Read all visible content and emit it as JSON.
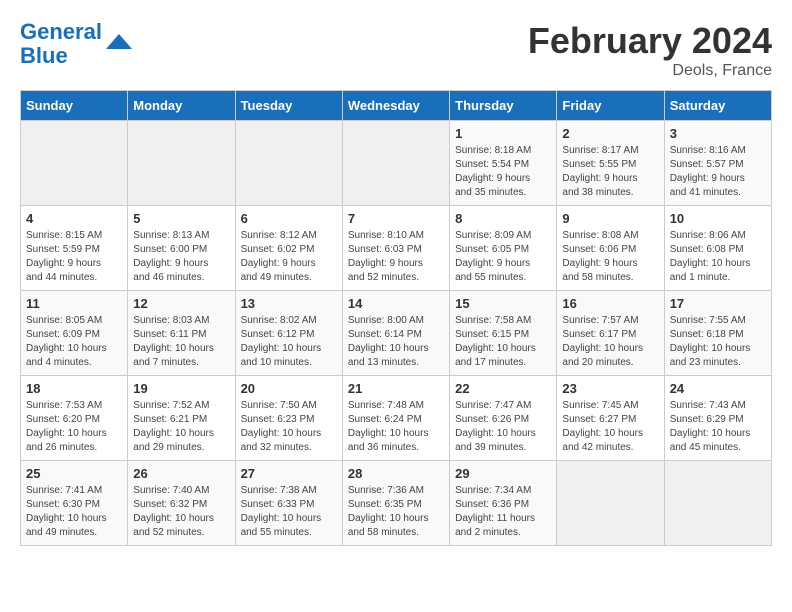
{
  "header": {
    "logo_line1": "General",
    "logo_line2": "Blue",
    "title": "February 2024",
    "subtitle": "Deols, France"
  },
  "days_of_week": [
    "Sunday",
    "Monday",
    "Tuesday",
    "Wednesday",
    "Thursday",
    "Friday",
    "Saturday"
  ],
  "weeks": [
    [
      {
        "day": "",
        "info": ""
      },
      {
        "day": "",
        "info": ""
      },
      {
        "day": "",
        "info": ""
      },
      {
        "day": "",
        "info": ""
      },
      {
        "day": "1",
        "info": "Sunrise: 8:18 AM\nSunset: 5:54 PM\nDaylight: 9 hours\nand 35 minutes."
      },
      {
        "day": "2",
        "info": "Sunrise: 8:17 AM\nSunset: 5:55 PM\nDaylight: 9 hours\nand 38 minutes."
      },
      {
        "day": "3",
        "info": "Sunrise: 8:16 AM\nSunset: 5:57 PM\nDaylight: 9 hours\nand 41 minutes."
      }
    ],
    [
      {
        "day": "4",
        "info": "Sunrise: 8:15 AM\nSunset: 5:59 PM\nDaylight: 9 hours\nand 44 minutes."
      },
      {
        "day": "5",
        "info": "Sunrise: 8:13 AM\nSunset: 6:00 PM\nDaylight: 9 hours\nand 46 minutes."
      },
      {
        "day": "6",
        "info": "Sunrise: 8:12 AM\nSunset: 6:02 PM\nDaylight: 9 hours\nand 49 minutes."
      },
      {
        "day": "7",
        "info": "Sunrise: 8:10 AM\nSunset: 6:03 PM\nDaylight: 9 hours\nand 52 minutes."
      },
      {
        "day": "8",
        "info": "Sunrise: 8:09 AM\nSunset: 6:05 PM\nDaylight: 9 hours\nand 55 minutes."
      },
      {
        "day": "9",
        "info": "Sunrise: 8:08 AM\nSunset: 6:06 PM\nDaylight: 9 hours\nand 58 minutes."
      },
      {
        "day": "10",
        "info": "Sunrise: 8:06 AM\nSunset: 6:08 PM\nDaylight: 10 hours\nand 1 minute."
      }
    ],
    [
      {
        "day": "11",
        "info": "Sunrise: 8:05 AM\nSunset: 6:09 PM\nDaylight: 10 hours\nand 4 minutes."
      },
      {
        "day": "12",
        "info": "Sunrise: 8:03 AM\nSunset: 6:11 PM\nDaylight: 10 hours\nand 7 minutes."
      },
      {
        "day": "13",
        "info": "Sunrise: 8:02 AM\nSunset: 6:12 PM\nDaylight: 10 hours\nand 10 minutes."
      },
      {
        "day": "14",
        "info": "Sunrise: 8:00 AM\nSunset: 6:14 PM\nDaylight: 10 hours\nand 13 minutes."
      },
      {
        "day": "15",
        "info": "Sunrise: 7:58 AM\nSunset: 6:15 PM\nDaylight: 10 hours\nand 17 minutes."
      },
      {
        "day": "16",
        "info": "Sunrise: 7:57 AM\nSunset: 6:17 PM\nDaylight: 10 hours\nand 20 minutes."
      },
      {
        "day": "17",
        "info": "Sunrise: 7:55 AM\nSunset: 6:18 PM\nDaylight: 10 hours\nand 23 minutes."
      }
    ],
    [
      {
        "day": "18",
        "info": "Sunrise: 7:53 AM\nSunset: 6:20 PM\nDaylight: 10 hours\nand 26 minutes."
      },
      {
        "day": "19",
        "info": "Sunrise: 7:52 AM\nSunset: 6:21 PM\nDaylight: 10 hours\nand 29 minutes."
      },
      {
        "day": "20",
        "info": "Sunrise: 7:50 AM\nSunset: 6:23 PM\nDaylight: 10 hours\nand 32 minutes."
      },
      {
        "day": "21",
        "info": "Sunrise: 7:48 AM\nSunset: 6:24 PM\nDaylight: 10 hours\nand 36 minutes."
      },
      {
        "day": "22",
        "info": "Sunrise: 7:47 AM\nSunset: 6:26 PM\nDaylight: 10 hours\nand 39 minutes."
      },
      {
        "day": "23",
        "info": "Sunrise: 7:45 AM\nSunset: 6:27 PM\nDaylight: 10 hours\nand 42 minutes."
      },
      {
        "day": "24",
        "info": "Sunrise: 7:43 AM\nSunset: 6:29 PM\nDaylight: 10 hours\nand 45 minutes."
      }
    ],
    [
      {
        "day": "25",
        "info": "Sunrise: 7:41 AM\nSunset: 6:30 PM\nDaylight: 10 hours\nand 49 minutes."
      },
      {
        "day": "26",
        "info": "Sunrise: 7:40 AM\nSunset: 6:32 PM\nDaylight: 10 hours\nand 52 minutes."
      },
      {
        "day": "27",
        "info": "Sunrise: 7:38 AM\nSunset: 6:33 PM\nDaylight: 10 hours\nand 55 minutes."
      },
      {
        "day": "28",
        "info": "Sunrise: 7:36 AM\nSunset: 6:35 PM\nDaylight: 10 hours\nand 58 minutes."
      },
      {
        "day": "29",
        "info": "Sunrise: 7:34 AM\nSunset: 6:36 PM\nDaylight: 11 hours\nand 2 minutes."
      },
      {
        "day": "",
        "info": ""
      },
      {
        "day": "",
        "info": ""
      }
    ]
  ]
}
